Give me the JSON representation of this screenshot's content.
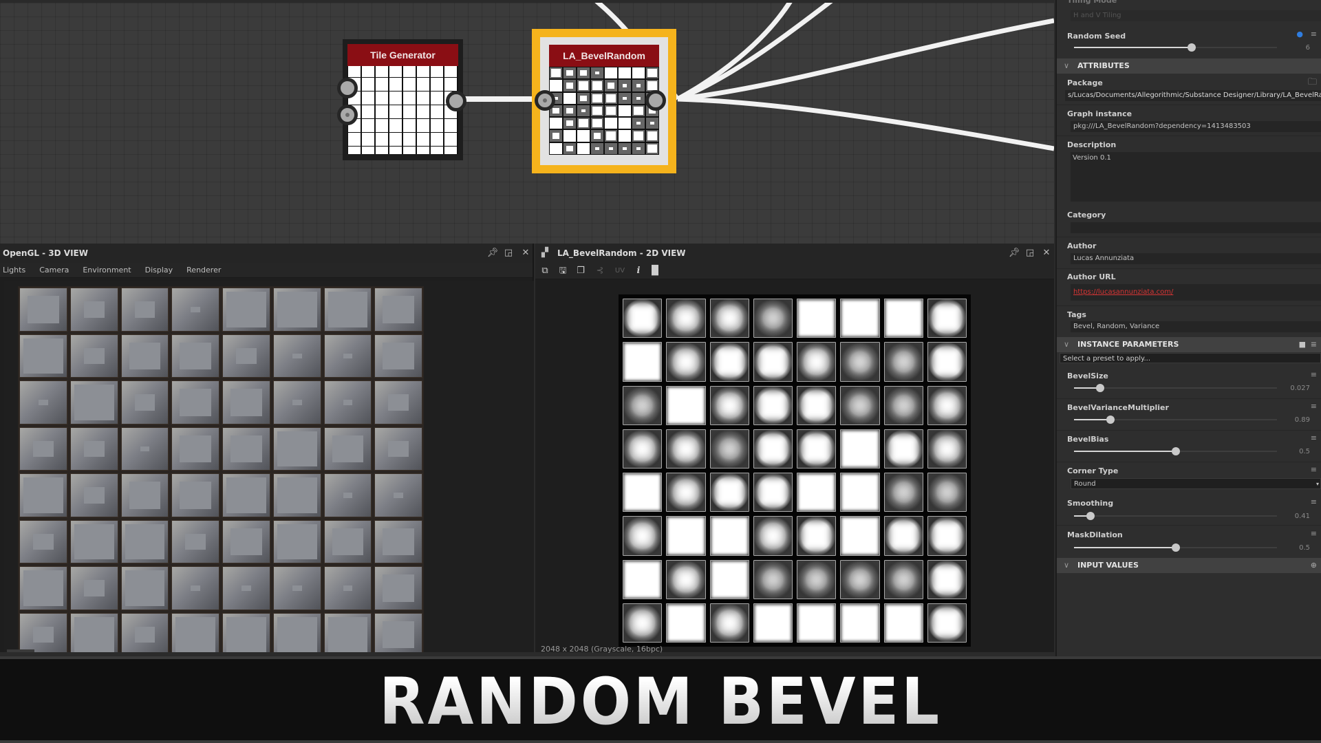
{
  "graph": {
    "nodes": [
      {
        "name": "tile-generator",
        "title": "Tile Generator",
        "selected": false
      },
      {
        "name": "la-bevelrandom",
        "title": "LA_BevelRandom",
        "selected": true
      }
    ],
    "accent_selection": "#f5b31c",
    "node_header_color": "#8a0e14"
  },
  "view3d": {
    "title": "OpenGL - 3D VIEW",
    "menu": [
      "Lights",
      "Camera",
      "Environment",
      "Display",
      "Renderer"
    ],
    "controls": {
      "pin": "pin-icon",
      "float": "float-icon",
      "close": "close-icon"
    }
  },
  "view2d": {
    "title": "LA_BevelRandom - 2D VIEW",
    "toolbar": [
      "copy-icon",
      "save-icon",
      "pages-icon",
      "tree-icon",
      "UV",
      "info-icon",
      "histogram-icon"
    ],
    "uv_label": "UV",
    "status": "2048 x 2048 (Grayscale, 16bpc)",
    "bevel_grid": [
      [
        1,
        2,
        2,
        3,
        0,
        0,
        0,
        1
      ],
      [
        0,
        2,
        1,
        1,
        2,
        3,
        3,
        1
      ],
      [
        3,
        0,
        2,
        1,
        1,
        3,
        3,
        2
      ],
      [
        2,
        2,
        3,
        1,
        1,
        0,
        1,
        2
      ],
      [
        0,
        2,
        1,
        1,
        0,
        0,
        3,
        3
      ],
      [
        2,
        0,
        0,
        2,
        1,
        0,
        1,
        1
      ],
      [
        0,
        2,
        0,
        3,
        3,
        3,
        3,
        1
      ],
      [
        2,
        0,
        2,
        0,
        0,
        0,
        0,
        1
      ]
    ]
  },
  "properties": {
    "tiling_mode": {
      "label": "Tiling Mode",
      "value": "H and V Tiling"
    },
    "random_seed": {
      "label": "Random Seed",
      "value": "6",
      "fraction": 0.58
    },
    "attributes": {
      "section": "ATTRIBUTES",
      "package": {
        "label": "Package",
        "value": "s/Lucas/Documents/Allegorithmic/Substance Designer/Library/LA_BevelRandom.sbs"
      },
      "graph_instance": {
        "label": "Graph instance",
        "value": "pkg:///LA_BevelRandom?dependency=1413483503"
      },
      "description": {
        "label": "Description",
        "value": "Version 0.1"
      },
      "category": {
        "label": "Category",
        "value": ""
      },
      "author": {
        "label": "Author",
        "value": "Lucas Annunziata"
      },
      "author_url": {
        "label": "Author URL",
        "value": "https://lucasannunziata.com/"
      },
      "tags": {
        "label": "Tags",
        "value": "Bevel, Random, Variance"
      }
    },
    "instance_parameters": {
      "section": "INSTANCE PARAMETERS",
      "preset_placeholder": "Select a preset to apply...",
      "params": [
        {
          "label": "BevelSize",
          "value": "0.027",
          "fraction": 0.13
        },
        {
          "label": "BevelVarianceMultiplier",
          "value": "0.89",
          "fraction": 0.18
        },
        {
          "label": "BevelBias",
          "value": "0.5",
          "fraction": 0.5
        },
        {
          "label": "Corner Type",
          "value": "Round"
        },
        {
          "label": "Smoothing",
          "value": "0.41",
          "fraction": 0.08
        },
        {
          "label": "MaskDilation",
          "value": "0.5",
          "fraction": 0.5
        }
      ]
    },
    "input_values": {
      "section": "INPUT VALUES"
    }
  },
  "banner": {
    "title": "RANDOM BEVEL"
  }
}
